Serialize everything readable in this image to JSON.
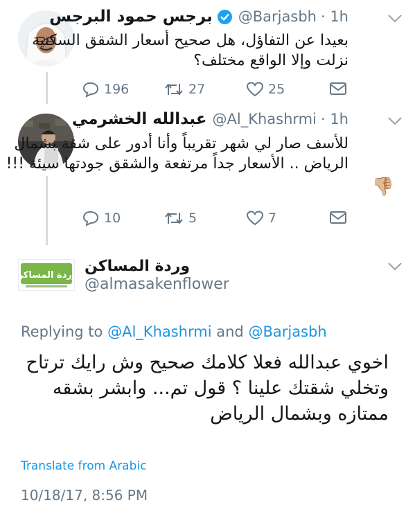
{
  "tweets": [
    {
      "display_name": "برجس حمود البرجس",
      "handle": "@Barjasbh",
      "time": "· 1h",
      "verified": true,
      "text_lines": [
        "بعيدا عن التفاؤل، هل صحيح أسعار الشقق السكنية",
        "نزلت وإلا الواقع مختلف؟"
      ],
      "reply_count": "196",
      "retweet_count": "27",
      "like_count": "25"
    },
    {
      "display_name": "عبدالله الخشرمي",
      "handle": "@Al_Khashrmi",
      "time": "· 1h",
      "verified": false,
      "text_lines": [
        "للأسف صار لي شهر تقريباً وأنا أدور على شقة بشمال",
        "الرياض .. الأسعار جداً مرتفعة والشقق جودتها سيئة !!!"
      ],
      "emoji": "👎🏼",
      "reply_count": "10",
      "retweet_count": "5",
      "like_count": "7"
    }
  ],
  "focus": {
    "display_name": "وردة المساكن",
    "handle": "@almasakenflower",
    "avatar_text": "وردة المساكن",
    "replying_prefix": "Replying to",
    "replying_user1": "@Al_Khashrmi",
    "replying_and": "and",
    "replying_user2": "@Barjasbh",
    "text_lines": [
      "اخوي عبدالله فعلا كلامك صحيح وش رايك ترتاح",
      "وتخلي شقتك علينا ؟ قول تم... وابشر بشقه",
      "ممتازه وبشمال الرياض"
    ],
    "translate_label": "Translate from Arabic",
    "timestamp": "10/18/17, 8:56 PM"
  },
  "colors": {
    "verified_blue": "#1da1f2",
    "icon_gray": "#657786",
    "link_blue": "#1b95e0",
    "thread_line": "#d6dbdf",
    "avatar_green": "#7ab648"
  }
}
